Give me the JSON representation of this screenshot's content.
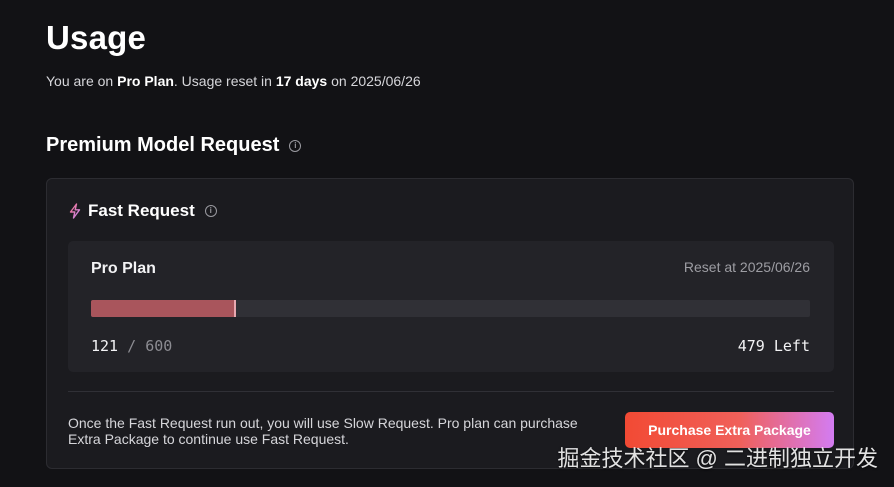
{
  "page": {
    "title": "Usage",
    "subtitle": {
      "prefix": "You are on ",
      "plan": "Pro Plan",
      "middle": ". Usage reset in ",
      "days": "17 days",
      "suffix": " on 2025/06/26"
    }
  },
  "section": {
    "title": "Premium Model Request",
    "info_icon": "i"
  },
  "card": {
    "header": "Fast Request",
    "header_icon": "bolt-icon",
    "info_icon": "i",
    "plan": {
      "name": "Pro Plan",
      "reset": "Reset at 2025/06/26",
      "used": "121",
      "separator": "/",
      "total": "600",
      "left": "479 Left",
      "progress_fraction": 0.2017
    },
    "footnote": "Once the Fast Request run out, you will use Slow Request. Pro plan can purchase Extra Package to continue use Fast Request.",
    "purchase_label": "Purchase Extra Package"
  },
  "watermark": "掘金技术社区 @ 二进制独立开发",
  "colors": {
    "background": "#121215",
    "card": "#1b1b1f",
    "progress_fill": "#a9555c",
    "button_gradient_start": "#f24a34",
    "button_gradient_end": "#d37cf2"
  }
}
